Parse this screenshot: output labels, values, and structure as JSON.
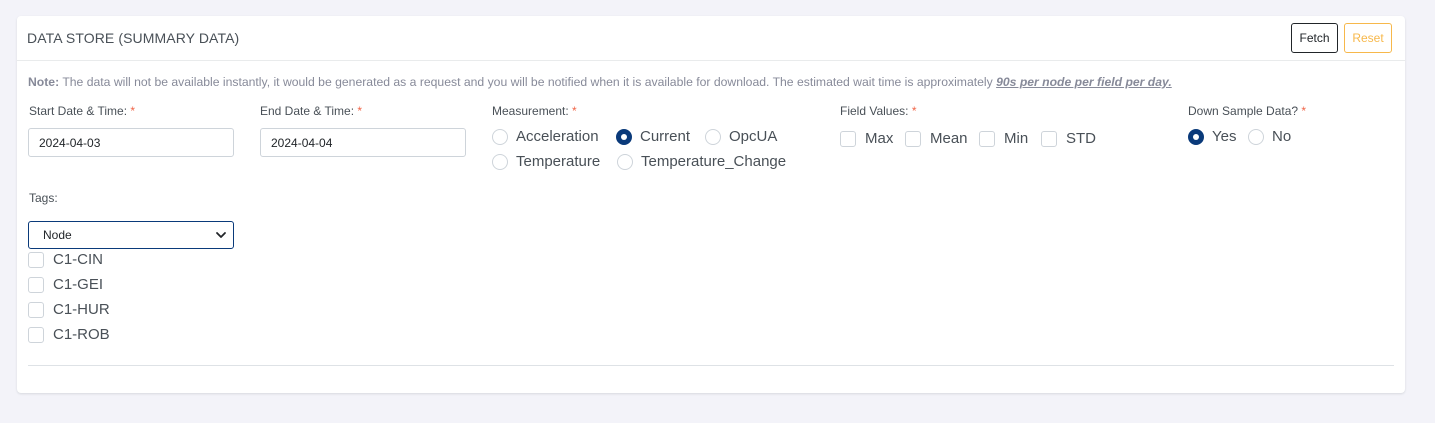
{
  "header": {
    "title": "DATA STORE (SUMMARY DATA)",
    "fetch_label": "Fetch",
    "reset_label": "Reset"
  },
  "note": {
    "prefix": "Note:",
    "text": " The data will not be available instantly, it would be generated as a request and you will be notified when it is available for download. The estimated wait time is approximately ",
    "emphasis": "90s per node per field per day."
  },
  "form": {
    "start": {
      "label": "Start Date & Time:",
      "required": "*",
      "value": "2024-04-03"
    },
    "end": {
      "label": "End Date & Time:",
      "required": "*",
      "value": "2024-04-04"
    },
    "measurement": {
      "label": "Measurement:",
      "required": "*",
      "options": [
        "Acceleration",
        "Current",
        "OpcUA",
        "Temperature",
        "Temperature_Change"
      ],
      "selected": "Current"
    },
    "field_values": {
      "label": "Field Values:",
      "required": "*",
      "options": [
        "Max",
        "Mean",
        "Min",
        "STD"
      ]
    },
    "down_sample": {
      "label": "Down Sample Data?",
      "required": "*",
      "options": [
        "Yes",
        "No"
      ],
      "selected": "Yes"
    },
    "tags": {
      "label": "Tags:",
      "select_value": "Node",
      "items": [
        "C1-CIN",
        "C1-GEI",
        "C1-HUR",
        "C1-ROB"
      ]
    }
  },
  "colors": {
    "accent": "#0a3a7a",
    "required": "#f06548",
    "reset": "#f7b84b"
  }
}
